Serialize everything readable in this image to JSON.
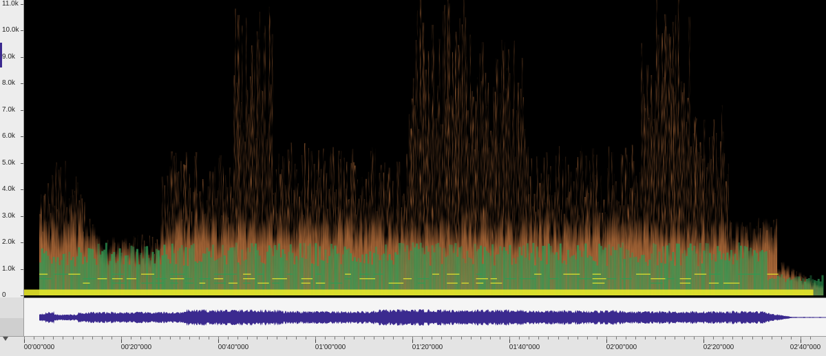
{
  "frequency_axis": {
    "labels": [
      {
        "text": "0",
        "value": 0
      },
      {
        "text": "1.0k",
        "value": 1000
      },
      {
        "text": "2.0k",
        "value": 2000
      },
      {
        "text": "3.0k",
        "value": 3000
      },
      {
        "text": "4.0k",
        "value": 4000
      },
      {
        "text": "5.0k",
        "value": 5000
      },
      {
        "text": "6.0k",
        "value": 6000
      },
      {
        "text": "7.0k",
        "value": 7000
      },
      {
        "text": "8.0k",
        "value": 8000
      },
      {
        "text": "9.0k",
        "value": 9000
      },
      {
        "text": "10.0k",
        "value": 10000
      },
      {
        "text": "11.0k",
        "value": 11000
      }
    ],
    "max_hz": 11000
  },
  "time_axis": {
    "labels": [
      {
        "text": "00'00\"000",
        "seconds": 0
      },
      {
        "text": "00'20\"000",
        "seconds": 20
      },
      {
        "text": "00'40\"000",
        "seconds": 40
      },
      {
        "text": "01'00\"000",
        "seconds": 60
      },
      {
        "text": "01'20\"000",
        "seconds": 80
      },
      {
        "text": "01'40\"000",
        "seconds": 100
      },
      {
        "text": "02'00\"000",
        "seconds": 120
      },
      {
        "text": "02'20\"000",
        "seconds": 140
      },
      {
        "text": "02'40\"000",
        "seconds": 160
      }
    ],
    "duration_seconds": 161.5,
    "end_seconds": 161.5
  },
  "colors": {
    "spectrogram_background": "#000000",
    "energy_low": "#b8703c",
    "energy_mid": "#2e9b55",
    "energy_high": "#e8e82a",
    "waveform": "#3b2a8f",
    "waveform_background": "#f5f5f5"
  }
}
